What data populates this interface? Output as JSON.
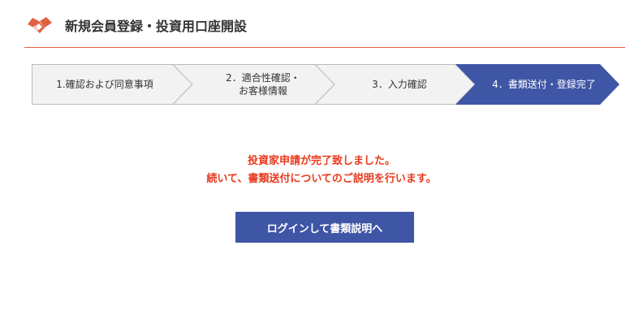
{
  "header": {
    "title": "新規会員登録・投資用口座開設",
    "logo_icon": "handshake-icon",
    "accent_color": "#e06040"
  },
  "steps": [
    {
      "label": "1.確認および同意事項",
      "active": false
    },
    {
      "label": "2．適合性確認・\nお客様情報",
      "active": false
    },
    {
      "label": "3．入力確認",
      "active": false
    },
    {
      "label": "4．書類送付・登録完了",
      "active": true
    }
  ],
  "step_colors": {
    "inactive_fill": "#f2f2f2",
    "inactive_border": "#bbbbbb",
    "active_fill": "#3f55a6"
  },
  "message": {
    "line1": "投資家申請が完了致しました。",
    "line2": "続いて、書類送付についてのご説明を行います。",
    "color": "#e83a1c"
  },
  "login_button": {
    "label": "ログインして書類説明へ",
    "color": "#3f55a6"
  }
}
